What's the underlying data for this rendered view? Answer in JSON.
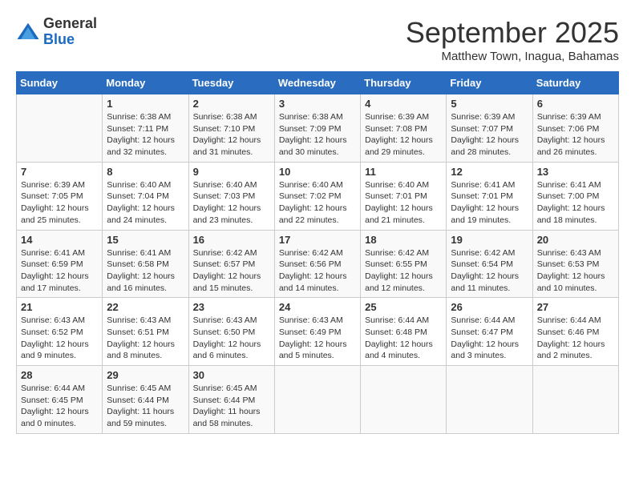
{
  "header": {
    "logo": {
      "general": "General",
      "blue": "Blue"
    },
    "title": "September 2025",
    "subtitle": "Matthew Town, Inagua, Bahamas"
  },
  "days_of_week": [
    "Sunday",
    "Monday",
    "Tuesday",
    "Wednesday",
    "Thursday",
    "Friday",
    "Saturday"
  ],
  "weeks": [
    [
      {
        "day": "",
        "info": ""
      },
      {
        "day": "1",
        "info": "Sunrise: 6:38 AM\nSunset: 7:11 PM\nDaylight: 12 hours\nand 32 minutes."
      },
      {
        "day": "2",
        "info": "Sunrise: 6:38 AM\nSunset: 7:10 PM\nDaylight: 12 hours\nand 31 minutes."
      },
      {
        "day": "3",
        "info": "Sunrise: 6:38 AM\nSunset: 7:09 PM\nDaylight: 12 hours\nand 30 minutes."
      },
      {
        "day": "4",
        "info": "Sunrise: 6:39 AM\nSunset: 7:08 PM\nDaylight: 12 hours\nand 29 minutes."
      },
      {
        "day": "5",
        "info": "Sunrise: 6:39 AM\nSunset: 7:07 PM\nDaylight: 12 hours\nand 28 minutes."
      },
      {
        "day": "6",
        "info": "Sunrise: 6:39 AM\nSunset: 7:06 PM\nDaylight: 12 hours\nand 26 minutes."
      }
    ],
    [
      {
        "day": "7",
        "info": "Sunrise: 6:39 AM\nSunset: 7:05 PM\nDaylight: 12 hours\nand 25 minutes."
      },
      {
        "day": "8",
        "info": "Sunrise: 6:40 AM\nSunset: 7:04 PM\nDaylight: 12 hours\nand 24 minutes."
      },
      {
        "day": "9",
        "info": "Sunrise: 6:40 AM\nSunset: 7:03 PM\nDaylight: 12 hours\nand 23 minutes."
      },
      {
        "day": "10",
        "info": "Sunrise: 6:40 AM\nSunset: 7:02 PM\nDaylight: 12 hours\nand 22 minutes."
      },
      {
        "day": "11",
        "info": "Sunrise: 6:40 AM\nSunset: 7:01 PM\nDaylight: 12 hours\nand 21 minutes."
      },
      {
        "day": "12",
        "info": "Sunrise: 6:41 AM\nSunset: 7:01 PM\nDaylight: 12 hours\nand 19 minutes."
      },
      {
        "day": "13",
        "info": "Sunrise: 6:41 AM\nSunset: 7:00 PM\nDaylight: 12 hours\nand 18 minutes."
      }
    ],
    [
      {
        "day": "14",
        "info": "Sunrise: 6:41 AM\nSunset: 6:59 PM\nDaylight: 12 hours\nand 17 minutes."
      },
      {
        "day": "15",
        "info": "Sunrise: 6:41 AM\nSunset: 6:58 PM\nDaylight: 12 hours\nand 16 minutes."
      },
      {
        "day": "16",
        "info": "Sunrise: 6:42 AM\nSunset: 6:57 PM\nDaylight: 12 hours\nand 15 minutes."
      },
      {
        "day": "17",
        "info": "Sunrise: 6:42 AM\nSunset: 6:56 PM\nDaylight: 12 hours\nand 14 minutes."
      },
      {
        "day": "18",
        "info": "Sunrise: 6:42 AM\nSunset: 6:55 PM\nDaylight: 12 hours\nand 12 minutes."
      },
      {
        "day": "19",
        "info": "Sunrise: 6:42 AM\nSunset: 6:54 PM\nDaylight: 12 hours\nand 11 minutes."
      },
      {
        "day": "20",
        "info": "Sunrise: 6:43 AM\nSunset: 6:53 PM\nDaylight: 12 hours\nand 10 minutes."
      }
    ],
    [
      {
        "day": "21",
        "info": "Sunrise: 6:43 AM\nSunset: 6:52 PM\nDaylight: 12 hours\nand 9 minutes."
      },
      {
        "day": "22",
        "info": "Sunrise: 6:43 AM\nSunset: 6:51 PM\nDaylight: 12 hours\nand 8 minutes."
      },
      {
        "day": "23",
        "info": "Sunrise: 6:43 AM\nSunset: 6:50 PM\nDaylight: 12 hours\nand 6 minutes."
      },
      {
        "day": "24",
        "info": "Sunrise: 6:43 AM\nSunset: 6:49 PM\nDaylight: 12 hours\nand 5 minutes."
      },
      {
        "day": "25",
        "info": "Sunrise: 6:44 AM\nSunset: 6:48 PM\nDaylight: 12 hours\nand 4 minutes."
      },
      {
        "day": "26",
        "info": "Sunrise: 6:44 AM\nSunset: 6:47 PM\nDaylight: 12 hours\nand 3 minutes."
      },
      {
        "day": "27",
        "info": "Sunrise: 6:44 AM\nSunset: 6:46 PM\nDaylight: 12 hours\nand 2 minutes."
      }
    ],
    [
      {
        "day": "28",
        "info": "Sunrise: 6:44 AM\nSunset: 6:45 PM\nDaylight: 12 hours\nand 0 minutes."
      },
      {
        "day": "29",
        "info": "Sunrise: 6:45 AM\nSunset: 6:44 PM\nDaylight: 11 hours\nand 59 minutes."
      },
      {
        "day": "30",
        "info": "Sunrise: 6:45 AM\nSunset: 6:44 PM\nDaylight: 11 hours\nand 58 minutes."
      },
      {
        "day": "",
        "info": ""
      },
      {
        "day": "",
        "info": ""
      },
      {
        "day": "",
        "info": ""
      },
      {
        "day": "",
        "info": ""
      }
    ]
  ]
}
